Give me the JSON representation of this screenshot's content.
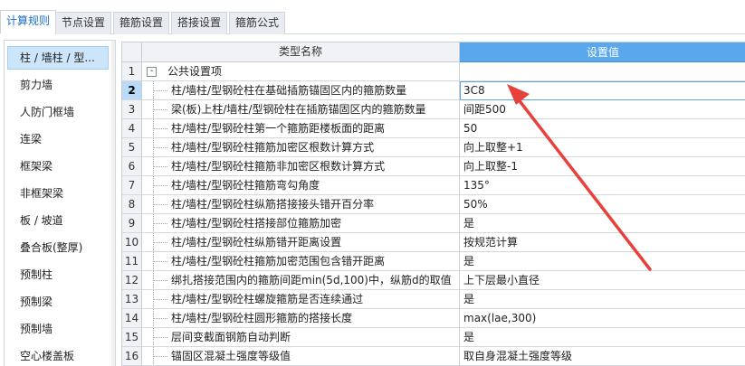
{
  "tabs": [
    {
      "label": "计算规则",
      "active": true
    },
    {
      "label": "节点设置",
      "active": false
    },
    {
      "label": "箍筋设置",
      "active": false
    },
    {
      "label": "搭接设置",
      "active": false
    },
    {
      "label": "箍筋公式",
      "active": false
    }
  ],
  "sidebar": {
    "items": [
      {
        "label": "柱 / 墙柱 / 型...",
        "selected": true
      },
      {
        "label": "剪力墙"
      },
      {
        "label": "人防门框墙"
      },
      {
        "label": "连梁"
      },
      {
        "label": "框架梁"
      },
      {
        "label": "非框架梁"
      },
      {
        "label": "板 / 坡道"
      },
      {
        "label": "叠合板(整厚)"
      },
      {
        "label": "预制柱"
      },
      {
        "label": "预制梁"
      },
      {
        "label": "预制墙"
      },
      {
        "label": "空心楼盖板"
      }
    ]
  },
  "grid": {
    "header_name": "类型名称",
    "header_value": "设置值",
    "rows": [
      {
        "num": "1",
        "name": "公共设置项",
        "value": "",
        "group": true,
        "toggle": "-"
      },
      {
        "num": "2",
        "name": "柱/墙柱/型钢砼柱在基础插筋锚固区内的箍筋数量",
        "value": "3C8",
        "selected": true
      },
      {
        "num": "3",
        "name": "梁(板)上柱/墙柱/型钢砼柱在插筋锚固区内的箍筋数量",
        "value": "间距500"
      },
      {
        "num": "4",
        "name": "柱/墙柱/型钢砼柱第一个箍筋距楼板面的距离",
        "value": "50"
      },
      {
        "num": "5",
        "name": "柱/墙柱/型钢砼柱箍筋加密区根数计算方式",
        "value": "向上取整+1"
      },
      {
        "num": "6",
        "name": "柱/墙柱/型钢砼柱箍筋非加密区根数计算方式",
        "value": "向上取整-1"
      },
      {
        "num": "7",
        "name": "柱/墙柱/型钢砼柱箍筋弯勾角度",
        "value": "135°"
      },
      {
        "num": "8",
        "name": "柱/墙柱/型钢砼柱纵筋搭接接头错开百分率",
        "value": "50%"
      },
      {
        "num": "9",
        "name": "柱/墙柱/型钢砼柱搭接部位箍筋加密",
        "value": "是"
      },
      {
        "num": "10",
        "name": "柱/墙柱/型钢砼柱纵筋错开距离设置",
        "value": "按规范计算"
      },
      {
        "num": "11",
        "name": "柱/墙柱/型钢砼柱箍筋加密范围包含错开距离",
        "value": "是"
      },
      {
        "num": "12",
        "name": "绑扎搭接范围内的箍筋间距min(5d,100)中，纵筋d的取值",
        "value": "上下层最小直径"
      },
      {
        "num": "13",
        "name": "柱/墙柱/型钢砼柱螺旋箍筋是否连续通过",
        "value": "是"
      },
      {
        "num": "14",
        "name": "柱/墙柱/型钢砼柱圆形箍筋的搭接长度",
        "value": "max(lae,300)"
      },
      {
        "num": "15",
        "name": "层间变截面钢筋自动判断",
        "value": "是"
      },
      {
        "num": "16",
        "name": "锚固区混凝土强度等级值",
        "value": "取自身混凝土强度等级"
      }
    ]
  },
  "annotation": {
    "type": "red-arrow",
    "color": "#e8413c"
  },
  "colors": {
    "accent": "#5aa7ee",
    "tab_active_text": "#1e6fc2",
    "selection": "#cde5fb"
  }
}
